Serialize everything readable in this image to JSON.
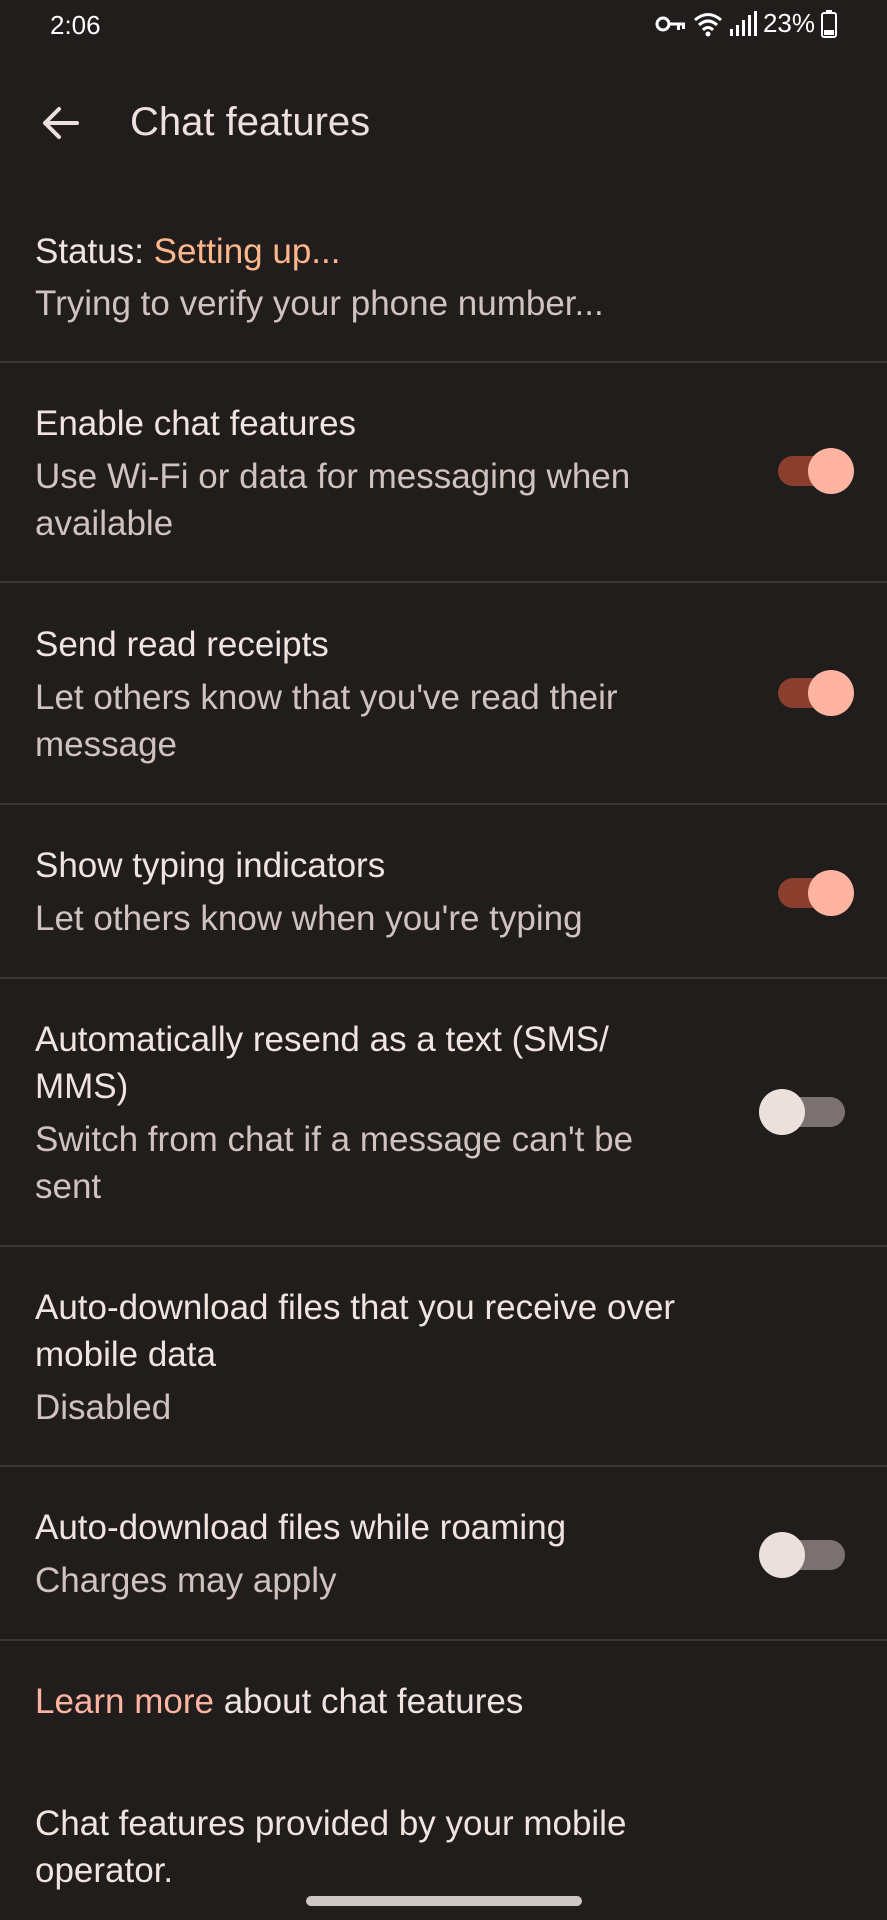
{
  "status_bar": {
    "time": "2:06",
    "battery": "23%",
    "icons": [
      "vpn-key-icon",
      "wifi-icon",
      "signal-icon",
      "battery-icon"
    ]
  },
  "app_bar": {
    "title": "Chat features",
    "back_icon": "arrow-back-icon"
  },
  "status": {
    "label": "Status: ",
    "value": "Setting up...",
    "detail": "Trying to verify your phone number..."
  },
  "settings": [
    {
      "title": "Enable chat features",
      "subtitle_line1": "Use Wi-Fi or data for messaging when",
      "subtitle_line2": "available",
      "toggle": "on"
    },
    {
      "title": "Send read receipts",
      "subtitle_line1": "Let others know that you've read their",
      "subtitle_line2": "message",
      "toggle": "on"
    },
    {
      "title": "Show typing indicators",
      "subtitle_line1": "Let others know when you're typing",
      "toggle": "on"
    },
    {
      "title_line1": "Automatically resend as a text (SMS/",
      "title_line2": "MMS)",
      "subtitle_line1": "Switch from chat if a message can't be",
      "subtitle_line2": "sent",
      "toggle": "off"
    },
    {
      "title_line1": "Auto-download files that you receive over",
      "title_line2": "mobile data",
      "subtitle_line1": "Disabled"
    },
    {
      "title": "Auto-download files while roaming",
      "subtitle_line1": "Charges may apply",
      "toggle": "off"
    }
  ],
  "learn_more": {
    "link": "Learn more",
    "rest": " about chat features"
  },
  "footer": {
    "line1": "Chat features provided by your mobile",
    "line2": "operator."
  },
  "colors": {
    "background": "#211d1c",
    "accent_status": "#ffb68c",
    "switch_on": "#ffb4a2"
  }
}
